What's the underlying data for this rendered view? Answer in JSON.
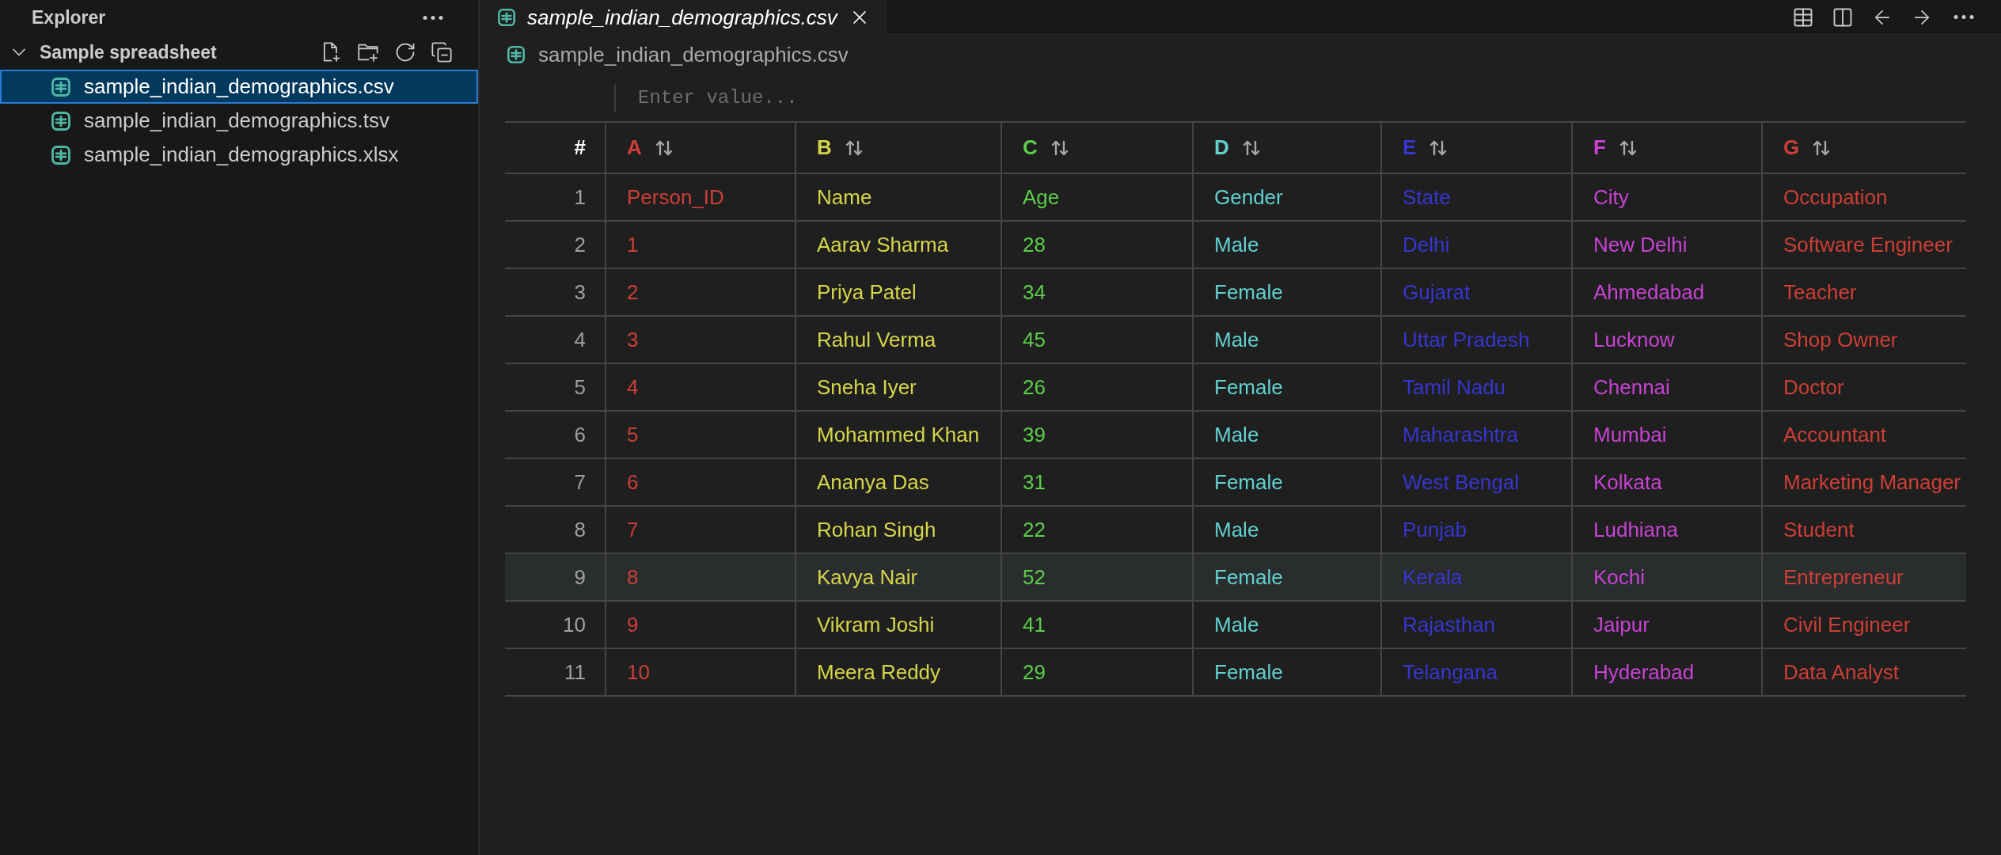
{
  "sidebar": {
    "title": "Explorer",
    "folder": {
      "name": "Sample spreadsheet",
      "expanded": true,
      "files": [
        {
          "name": "sample_indian_demographics.csv",
          "selected": true
        },
        {
          "name": "sample_indian_demographics.tsv",
          "selected": false
        },
        {
          "name": "sample_indian_demographics.xlsx",
          "selected": false
        }
      ]
    }
  },
  "tabs": [
    {
      "label": "sample_indian_demographics.csv",
      "selected": true,
      "preview": true
    }
  ],
  "breadcrumb": [
    "sample_indian_demographics.csv"
  ],
  "value_input": {
    "placeholder": "Enter value..."
  },
  "table": {
    "index_header": "#",
    "columns": [
      {
        "letter": "A",
        "color": "#cd3f35"
      },
      {
        "letter": "B",
        "color": "#d6d64a"
      },
      {
        "letter": "C",
        "color": "#5cce4a"
      },
      {
        "letter": "D",
        "color": "#62d0d0"
      },
      {
        "letter": "E",
        "color": "#3636d0"
      },
      {
        "letter": "F",
        "color": "#c843d4"
      },
      {
        "letter": "G",
        "color": "#cd3f35"
      }
    ],
    "rows": [
      {
        "number": "1",
        "highlighted": false,
        "cells": [
          "Person_ID",
          "Name",
          "Age",
          "Gender",
          "State",
          "City",
          "Occupation"
        ]
      },
      {
        "number": "2",
        "highlighted": false,
        "cells": [
          "1",
          "Aarav Sharma",
          "28",
          "Male",
          "Delhi",
          "New Delhi",
          "Software Engineer"
        ]
      },
      {
        "number": "3",
        "highlighted": false,
        "cells": [
          "2",
          "Priya Patel",
          "34",
          "Female",
          "Gujarat",
          "Ahmedabad",
          "Teacher"
        ]
      },
      {
        "number": "4",
        "highlighted": false,
        "cells": [
          "3",
          "Rahul Verma",
          "45",
          "Male",
          "Uttar Pradesh",
          "Lucknow",
          "Shop Owner"
        ]
      },
      {
        "number": "5",
        "highlighted": false,
        "cells": [
          "4",
          "Sneha Iyer",
          "26",
          "Female",
          "Tamil Nadu",
          "Chennai",
          "Doctor"
        ]
      },
      {
        "number": "6",
        "highlighted": false,
        "cells": [
          "5",
          "Mohammed Khan",
          "39",
          "Male",
          "Maharashtra",
          "Mumbai",
          "Accountant"
        ]
      },
      {
        "number": "7",
        "highlighted": false,
        "cells": [
          "6",
          "Ananya Das",
          "31",
          "Female",
          "West Bengal",
          "Kolkata",
          "Marketing Manager"
        ]
      },
      {
        "number": "8",
        "highlighted": false,
        "cells": [
          "7",
          "Rohan Singh",
          "22",
          "Male",
          "Punjab",
          "Ludhiana",
          "Student"
        ]
      },
      {
        "number": "9",
        "highlighted": true,
        "cells": [
          "8",
          "Kavya Nair",
          "52",
          "Female",
          "Kerala",
          "Kochi",
          "Entrepreneur"
        ]
      },
      {
        "number": "10",
        "highlighted": false,
        "cells": [
          "9",
          "Vikram Joshi",
          "41",
          "Male",
          "Rajasthan",
          "Jaipur",
          "Civil Engineer"
        ]
      },
      {
        "number": "11",
        "highlighted": false,
        "cells": [
          "10",
          "Meera Reddy",
          "29",
          "Female",
          "Telangana",
          "Hyderabad",
          "Data Analyst"
        ]
      }
    ]
  }
}
